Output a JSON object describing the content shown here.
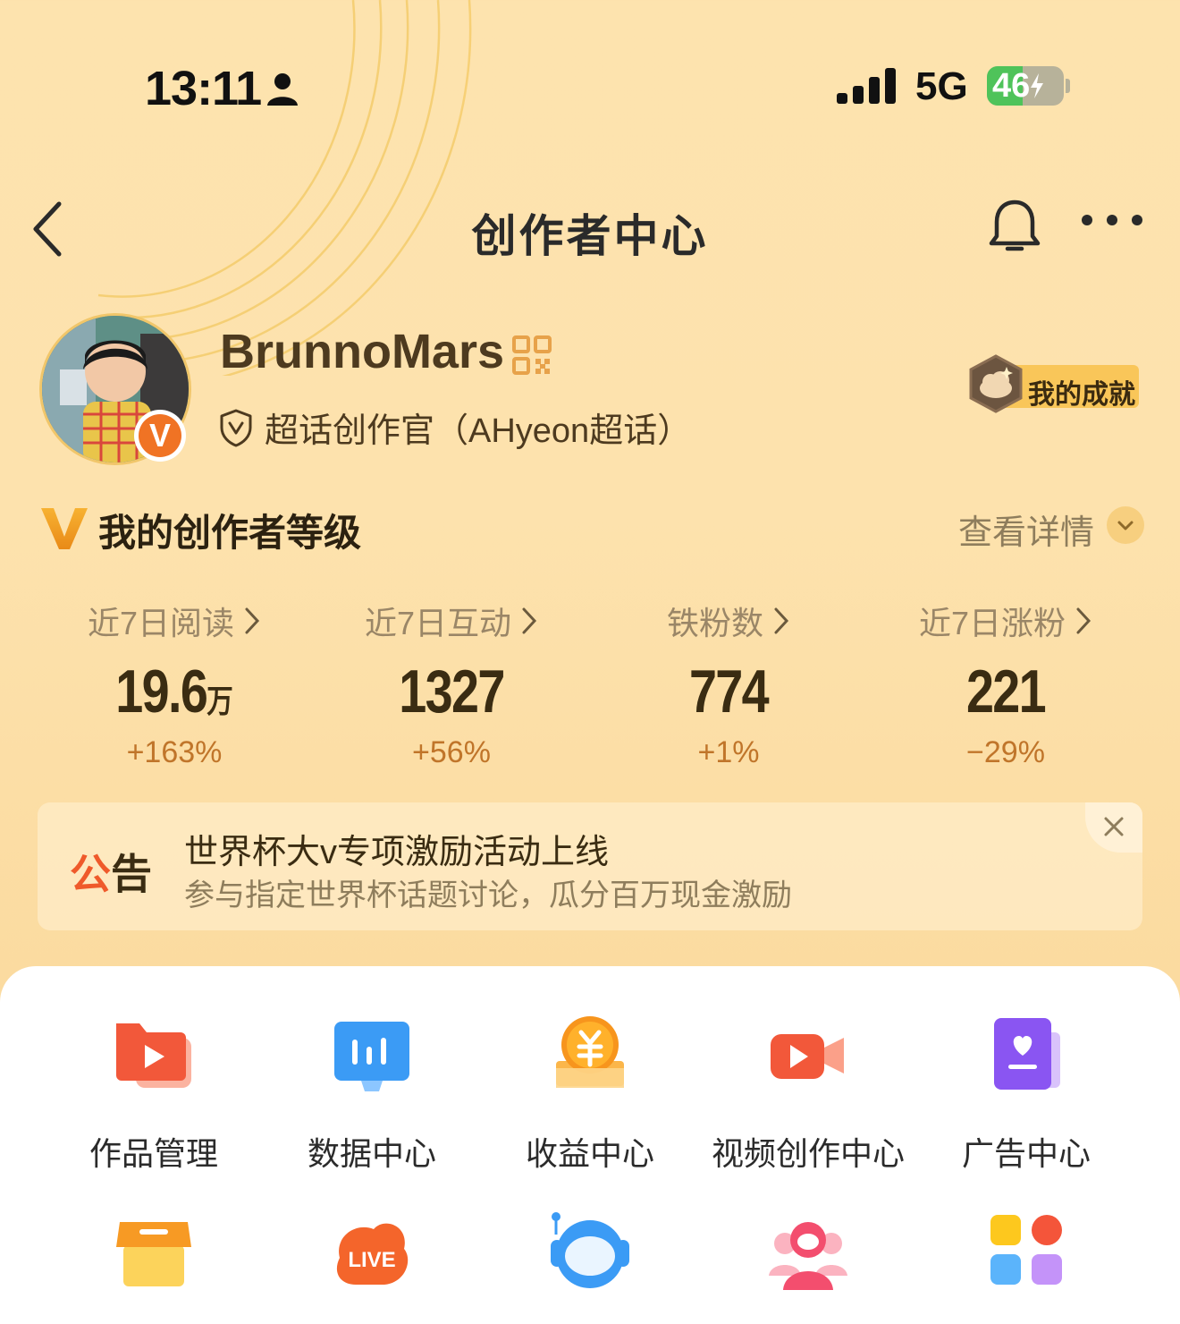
{
  "status_bar": {
    "time": "13:11",
    "network": "5G",
    "battery": "46",
    "battery_level_percent": 46
  },
  "nav": {
    "title": "创作者中心"
  },
  "profile": {
    "username": "BrunnoMars",
    "avatar_badge": "V",
    "role": "超话创作官（AHyeon超话）",
    "achievement_label": "我的成就"
  },
  "level": {
    "title": "我的创作者等级",
    "details_label": "查看详情"
  },
  "stats": [
    {
      "label": "近7日阅读",
      "value": "19.6",
      "unit": "万",
      "change": "+163%"
    },
    {
      "label": "近7日互动",
      "value": "1327",
      "unit": "",
      "change": "+56%"
    },
    {
      "label": "铁粉数",
      "value": "774",
      "unit": "",
      "change": "+1%"
    },
    {
      "label": "近7日涨粉",
      "value": "221",
      "unit": "",
      "change": "−29%"
    }
  ],
  "notice": {
    "tag_part1": "公",
    "tag_part2": "告",
    "title": "世界杯大v专项激励活动上线",
    "subtitle": "参与指定世界杯话题讨论，瓜分百万现金激励"
  },
  "tools_row1": [
    {
      "label": "作品管理",
      "icon": "works-folder-icon"
    },
    {
      "label": "数据中心",
      "icon": "data-chart-icon"
    },
    {
      "label": "收益中心",
      "icon": "yuan-coin-icon"
    },
    {
      "label": "视频创作中心",
      "icon": "video-camera-icon"
    },
    {
      "label": "广告中心",
      "icon": "ad-book-icon"
    }
  ],
  "tools_row2_icons": [
    "shop-icon",
    "live-icon",
    "astronaut-icon",
    "people-icon",
    "apps-grid-icon"
  ],
  "colors": {
    "accent_orange": "#f07324",
    "change_text": "#c0752a",
    "background": "#fde2ad"
  }
}
